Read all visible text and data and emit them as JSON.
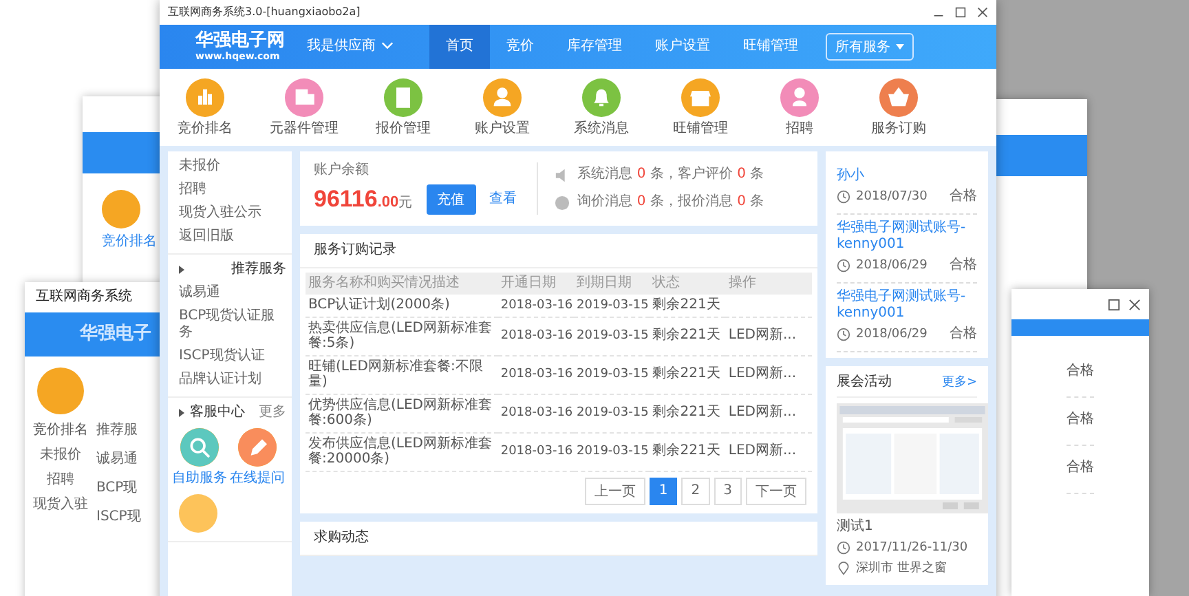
{
  "left_window": {
    "title": "互联网商务系统",
    "logo": "华强电子",
    "feature": "竞价排名",
    "feature_b": "竞价排名",
    "links": [
      "未报价",
      "招聘",
      "现货入驻"
    ],
    "side_items": [
      "推荐服",
      "诚易通",
      "BCP现",
      "ISCP现"
    ]
  },
  "right_window": {
    "results": [
      "合格",
      "合格",
      "合格"
    ]
  },
  "window": {
    "title": "互联网商务系统3.0-[huangxiaobo2a]"
  },
  "nav": {
    "logo": "华强电子网",
    "logo_url": "www.hqew.com",
    "role": "我是供应商",
    "services_button": "所有服务",
    "tabs": [
      {
        "label": "首页",
        "selected": true
      },
      {
        "label": "竞价",
        "selected": false
      },
      {
        "label": "库存管理",
        "selected": false
      },
      {
        "label": "账户设置",
        "selected": false
      },
      {
        "label": "旺铺管理",
        "selected": false
      }
    ]
  },
  "features": [
    {
      "label": "竞价排名",
      "color": "#f5a623"
    },
    {
      "label": "元器件管理",
      "color": "#f28cb8"
    },
    {
      "label": "报价管理",
      "color": "#7cc242"
    },
    {
      "label": "账户设置",
      "color": "#f5a623"
    },
    {
      "label": "系统消息",
      "color": "#7cc242"
    },
    {
      "label": "旺铺管理",
      "color": "#f5a623"
    },
    {
      "label": "招聘",
      "color": "#f28cb8"
    },
    {
      "label": "服务订购",
      "color": "#ee7f4e"
    }
  ],
  "sidebar": {
    "links": [
      "未报价",
      "招聘",
      "现货入驻公示",
      "返回旧版"
    ],
    "recommended": {
      "title": "推荐服务",
      "items": [
        "诚易通",
        "BCP现货认证服务",
        "ISCP现货认证",
        "品牌认证计划"
      ]
    },
    "support": {
      "title": "客服中心",
      "more": "更多",
      "actions": [
        {
          "label": "自助服务",
          "color": "#5cc8be"
        },
        {
          "label": "在线提问",
          "color": "#f98d5c"
        }
      ]
    }
  },
  "balance": {
    "label": "账户余额",
    "amount": "96116",
    "decimals": ".00",
    "unit": "元",
    "recharge": "充值",
    "view": "查看"
  },
  "messages": [
    {
      "label": "系统消息",
      "count": "0",
      "middle": "条，客户评价",
      "count2": "0",
      "unit": "条"
    },
    {
      "label": "询价消息",
      "count": "0",
      "middle": "条，报价消息",
      "count2": "0",
      "unit": "条"
    }
  ],
  "orders": {
    "title": "服务订购记录",
    "columns": [
      "服务名称和购买情况描述",
      "开通日期",
      "到期日期",
      "状态",
      "操作"
    ],
    "rows": [
      [
        "BCP认证计划(2000条)",
        "2018-03-16",
        "2019-03-15",
        "剩余221天",
        ""
      ],
      [
        "热卖供应信息(LED网新标准套餐:5条)",
        "2018-03-16",
        "2019-03-15",
        "剩余221天",
        "LED网新..."
      ],
      [
        "旺铺(LED网新标准套餐:不限量)",
        "2018-03-16",
        "2019-03-15",
        "剩余221天",
        "LED网新..."
      ],
      [
        "优势供应信息(LED网新标准套餐:600条)",
        "2018-03-16",
        "2019-03-15",
        "剩余221天",
        "LED网新..."
      ],
      [
        "发布供应信息(LED网新标准套餐:20000条)",
        "2018-03-16",
        "2019-03-15",
        "剩余221天",
        "LED网新..."
      ]
    ],
    "pagination": {
      "prev": "上一页",
      "next": "下一页",
      "pages": [
        {
          "label": "1",
          "selected": true
        },
        {
          "label": "2",
          "selected": false
        },
        {
          "label": "3",
          "selected": false
        }
      ]
    }
  },
  "purchase": {
    "title": "求购动态"
  },
  "inspections": [
    {
      "name": "孙小",
      "date": "2018/07/30",
      "result": "合格"
    },
    {
      "name": "华强电子网测试账号-kenny001",
      "date": "2018/06/29",
      "result": "合格"
    },
    {
      "name": "华强电子网测试账号-kenny001",
      "date": "2018/06/29",
      "result": "合格"
    }
  ],
  "expo": {
    "title": "展会活动",
    "more": "更多>",
    "caption": "测试1",
    "date": "2017/11/26-11/30",
    "place": "深圳市 世界之窗"
  }
}
